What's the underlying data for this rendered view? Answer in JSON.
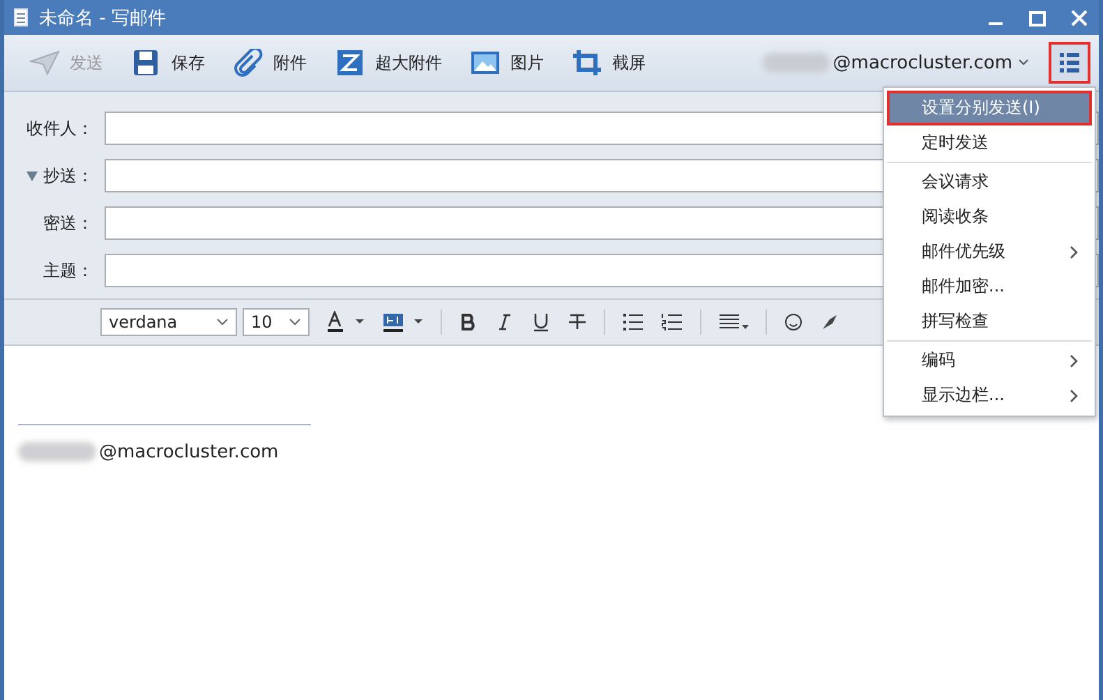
{
  "window": {
    "title": "未命名 - 写邮件"
  },
  "toolbar": {
    "buttons": [
      {
        "label": "发送",
        "disabled": true
      },
      {
        "label": "保存",
        "disabled": false
      },
      {
        "label": "附件",
        "disabled": false
      },
      {
        "label": "超大附件",
        "disabled": false
      },
      {
        "label": "图片",
        "disabled": false
      },
      {
        "label": "截屏",
        "disabled": false
      }
    ],
    "account": "@macrocluster.com",
    "menu_button": {
      "outlined": true
    }
  },
  "fields": [
    {
      "label": "收件人：",
      "collapsible": false
    },
    {
      "label": "抄送：",
      "collapsible": true
    },
    {
      "label": "密送：",
      "collapsible": false
    },
    {
      "label": "主题：",
      "collapsible": false
    }
  ],
  "format_bar": {
    "font": "verdana",
    "size": "10"
  },
  "body": {
    "signature": "@macrocluster.com"
  },
  "menu": {
    "groups": [
      [
        {
          "label": "设置分别发送(I)",
          "selected": true,
          "outlined": true,
          "submenu": false
        },
        {
          "label": "定时发送",
          "selected": false,
          "outlined": false,
          "submenu": false
        }
      ],
      [
        {
          "label": "会议请求",
          "selected": false,
          "outlined": false,
          "submenu": false
        },
        {
          "label": "阅读收条",
          "selected": false,
          "outlined": false,
          "submenu": false
        },
        {
          "label": "邮件优先级",
          "selected": false,
          "outlined": false,
          "submenu": true
        },
        {
          "label": "邮件加密...",
          "selected": false,
          "outlined": false,
          "submenu": false
        },
        {
          "label": "拼写检查",
          "selected": false,
          "outlined": false,
          "submenu": false
        }
      ],
      [
        {
          "label": "编码",
          "selected": false,
          "outlined": false,
          "submenu": true
        },
        {
          "label": "显示边栏...",
          "selected": false,
          "outlined": false,
          "submenu": true
        }
      ]
    ]
  }
}
